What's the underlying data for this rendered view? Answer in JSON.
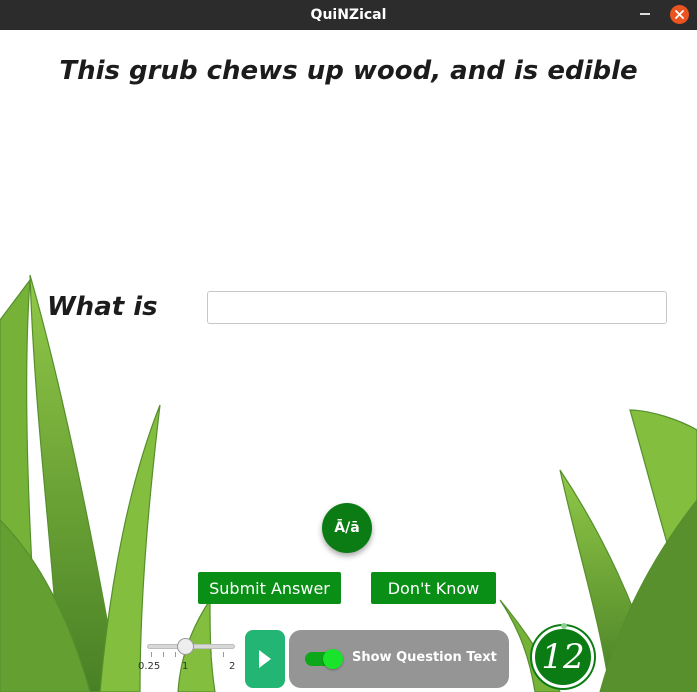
{
  "window": {
    "title": "QuiNZical"
  },
  "question": {
    "text": "This grub chews up wood, and is edible"
  },
  "answer": {
    "prompt": "What is",
    "value": "",
    "placeholder": ""
  },
  "macron": {
    "label": "Ā/ā"
  },
  "buttons": {
    "submit": "Submit Answer",
    "dont_know": "Don't Know"
  },
  "speed_slider": {
    "min_label": "0.25",
    "mid_label": "1",
    "max_label": "2",
    "value": 1
  },
  "toggle": {
    "label": "Show Question Text",
    "on": true
  },
  "timer": {
    "value": "12"
  },
  "colors": {
    "button_green": "#0a8f16",
    "play_green": "#22b573",
    "close_orange": "#e95420"
  }
}
